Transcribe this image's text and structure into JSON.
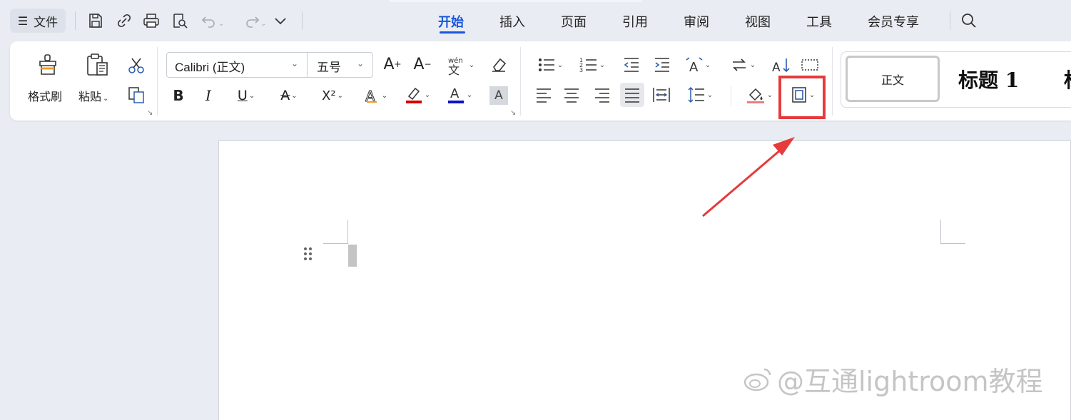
{
  "toolbar": {
    "file_label": "文件",
    "menu_glyph": "☰",
    "quick_access_icons": [
      "save-icon",
      "share-link-icon",
      "print-icon",
      "print-preview-icon",
      "undo-icon",
      "redo-icon",
      "more-dropdown-icon"
    ]
  },
  "tabs": [
    {
      "label": "开始",
      "active": true
    },
    {
      "label": "插入",
      "active": false
    },
    {
      "label": "页面",
      "active": false
    },
    {
      "label": "引用",
      "active": false
    },
    {
      "label": "审阅",
      "active": false
    },
    {
      "label": "视图",
      "active": false
    },
    {
      "label": "工具",
      "active": false
    },
    {
      "label": "会员专享",
      "active": false
    }
  ],
  "ribbon": {
    "format_painter_label": "格式刷",
    "paste_label": "粘贴",
    "font_name": "Calibri (正文)",
    "font_size": "五号",
    "grow_font": "A",
    "shrink_font": "A",
    "bold": "B",
    "italic": "I",
    "underline": "U",
    "strikethrough": "A",
    "superscript": "X²",
    "highlight_color": "#d40000",
    "font_color": "#1010c8"
  },
  "styles": {
    "normal_label": "正文",
    "heading1_label": "标题 1",
    "heading_more": "标"
  },
  "annotation": {
    "highlight_color": "#e53b3b",
    "target": "border-icon"
  },
  "watermark": {
    "text": "@互通lightroom教程"
  }
}
